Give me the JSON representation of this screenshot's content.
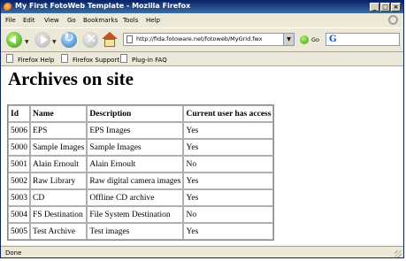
{
  "window": {
    "title": "My First FotoWeb Template - Mozilla Firefox"
  },
  "menu": [
    "File",
    "Edit",
    "View",
    "Go",
    "Bookmarks",
    "Tools",
    "Help"
  ],
  "toolbar": {
    "url": "http://fida.fotoware.net/fotoweb/MyGrid.fwx",
    "go_label": "Go"
  },
  "bookmarks": [
    "Firefox Help",
    "Firefox Support",
    "Plug-in FAQ"
  ],
  "page": {
    "heading": "Archives on site",
    "columns": [
      "Id",
      "Name",
      "Description",
      "Current user has access"
    ],
    "rows": [
      [
        "5006",
        "EPS",
        "EPS Images",
        "Yes"
      ],
      [
        "5000",
        "Sample Images",
        "Sample Images",
        "Yes"
      ],
      [
        "5001",
        "Alain Ernoult",
        "Alain Ernoult",
        "No"
      ],
      [
        "5002",
        "Raw Library",
        "Raw digital camera images",
        "Yes"
      ],
      [
        "5003",
        "CD",
        "Offline CD archive",
        "Yes"
      ],
      [
        "5004",
        "FS Destination",
        "File System Destination",
        "No"
      ],
      [
        "5005",
        "Test Archive",
        "Test images",
        "Yes"
      ]
    ]
  },
  "status": {
    "text": "Done"
  }
}
